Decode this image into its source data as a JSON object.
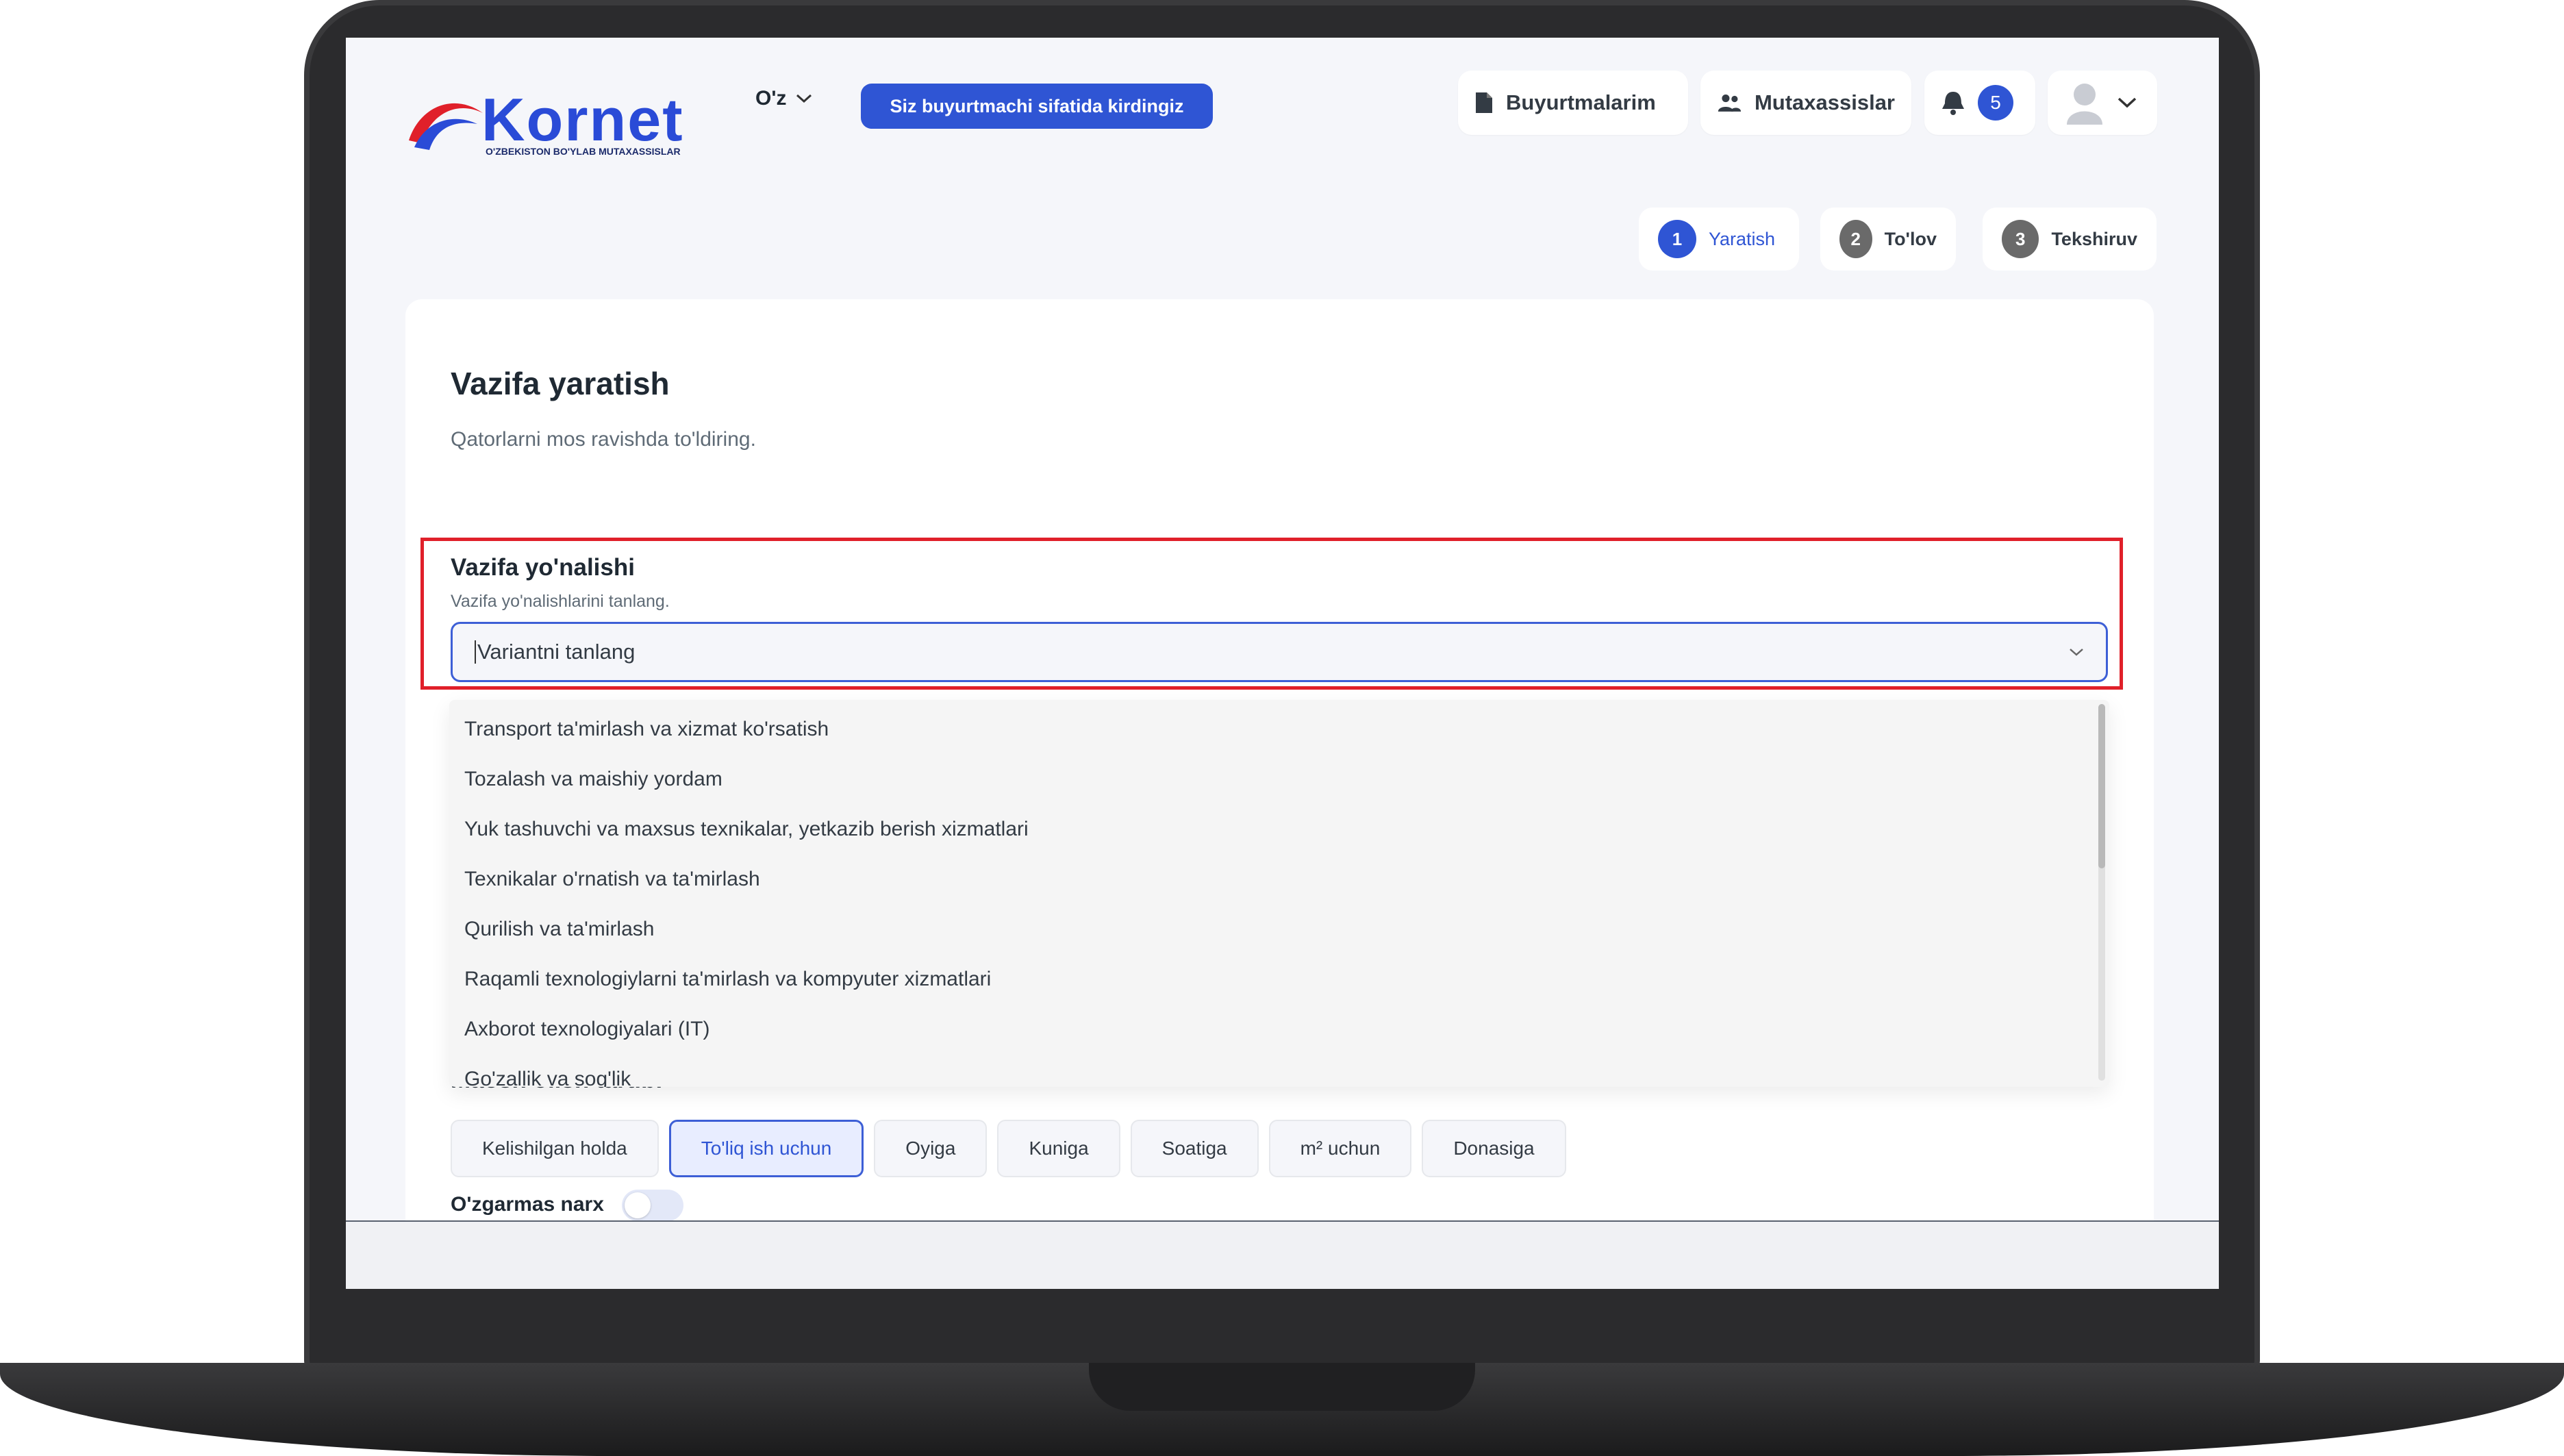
{
  "brand": {
    "name": "Kornet",
    "tagline": "O'ZBEKISTON BO'YLAB MUTAXASSISLAR",
    "color_blue": "#2a4bd7",
    "color_red": "#e0202a"
  },
  "header": {
    "language": "O'z",
    "role_badge": "Siz buyurtmachi sifatida kirdingiz",
    "orders_label": "Buyurtmalarim",
    "specialists_label": "Mutaxassislar",
    "notifications_count": "5"
  },
  "steps": [
    {
      "num": "1",
      "label": "Yaratish"
    },
    {
      "num": "2",
      "label": "To'lov"
    },
    {
      "num": "3",
      "label": "Tekshiruv"
    }
  ],
  "form": {
    "title": "Vazifa yaratish",
    "subtitle": "Qatorlarni mos ravishda to'ldiring.",
    "direction_label": "Vazifa yo'nalishi",
    "direction_hint": "Vazifa yo'nalishlarini tanlang.",
    "direction_placeholder": "Variantni tanlang",
    "dropdown_options": [
      "Transport ta'mirlash va xizmat ko'rsatish",
      "Tozalash va maishiy yordam",
      "Yuk tashuvchi va maxsus texnikalar, yetkazib berish xizmatlari",
      "Texnikalar o'rnatish va ta'mirlash",
      "Qurilish va ta'mirlash",
      "Raqamli texnologiylarni ta'mirlash va kompyuter xizmatlari",
      "Axborot texnologiyalari (IT)",
      "Go'zallik va sog'lik"
    ],
    "payment_label": "Maosh olish tartibi",
    "payment_options": [
      "Kelishilgan holda",
      "To'liq ish uchun",
      "Oyiga",
      "Kuniga",
      "Soatiga",
      "m² uchun",
      "Donasiga"
    ],
    "payment_selected": "To'liq ish uchun",
    "fixed_price_label": "O'zgarmas narx",
    "fixed_price_enabled": false
  },
  "icons": {
    "lang_caret": "chevron-down-icon",
    "orders": "document-icon",
    "specialists": "users-icon",
    "notifications": "bell-icon",
    "avatar": "avatar-icon",
    "select_caret": "chevron-down-icon"
  }
}
